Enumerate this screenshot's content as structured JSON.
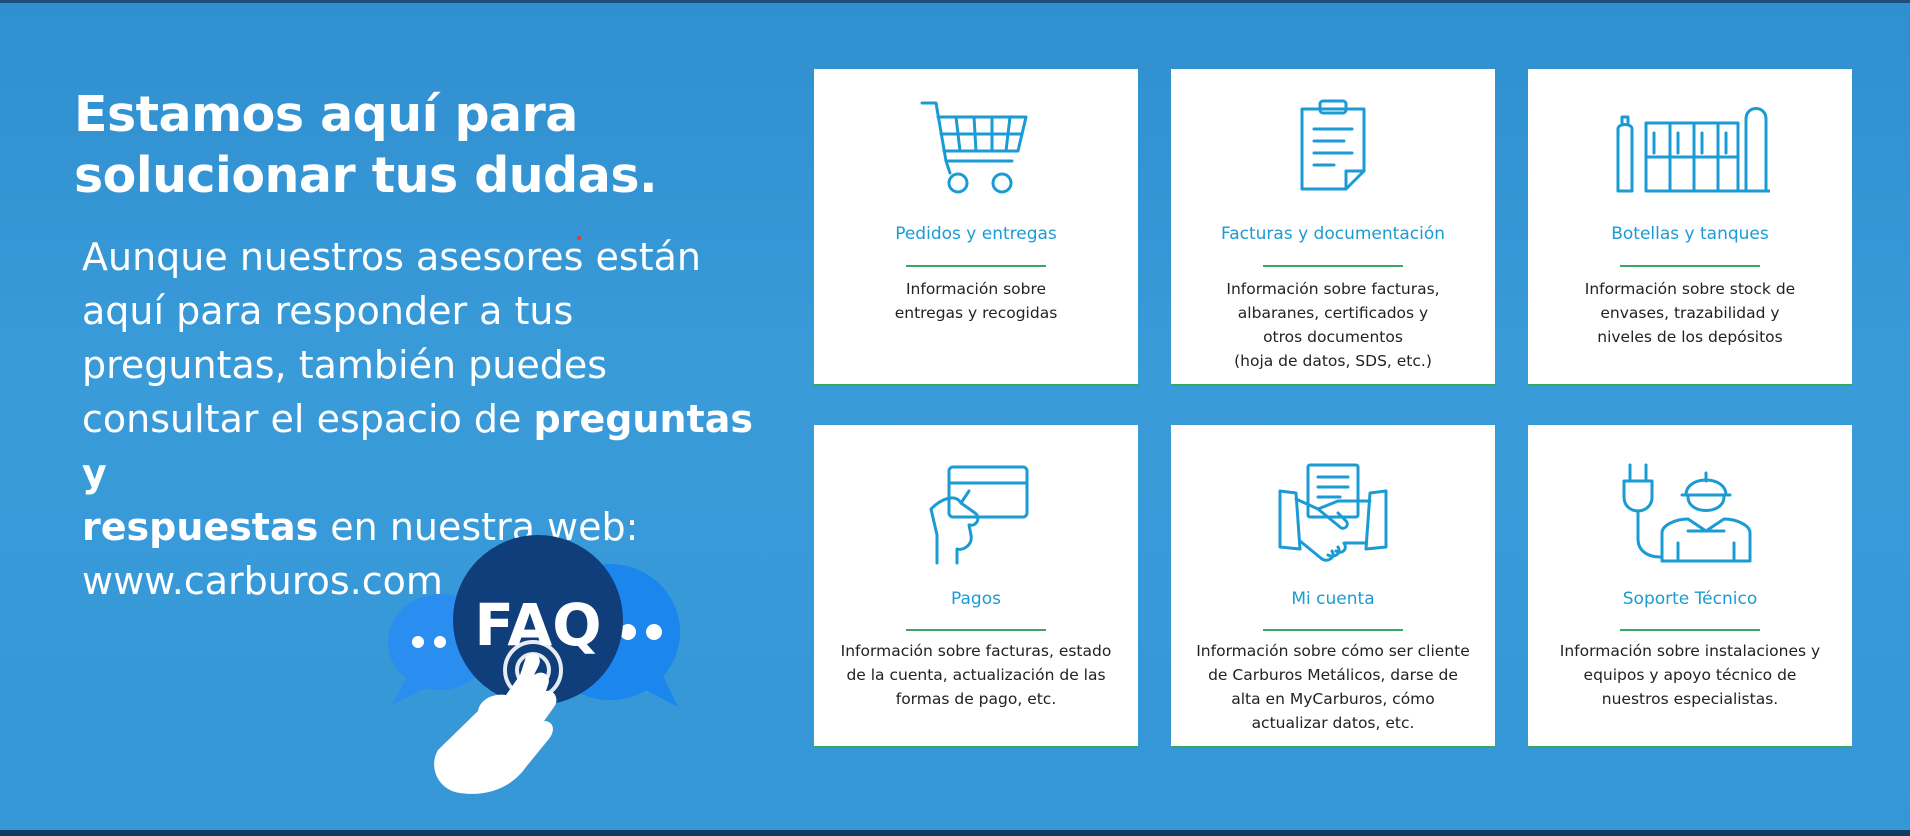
{
  "headline": {
    "line1": "Estamos aquí para",
    "line2": "solucionar tus dudas."
  },
  "intro": {
    "line1": "Aunque nuestros asesores están",
    "line2": "aquí para responder a tus",
    "line3": "preguntas, también puedes",
    "line4_normal": "consultar el espacio de ",
    "line4_bold": "preguntas y",
    "line5_bold": "respuestas",
    "line5_normal": " en nuestra web:",
    "line6": "www.carburos.com"
  },
  "faq_badge": {
    "label": "FAQ"
  },
  "colors": {
    "background": "#3597d6",
    "accent": "#1b9bd3",
    "rule": "#3aa860",
    "faq_dark": "#0f3e7a",
    "bubble": "#1a8cf0"
  },
  "cards": [
    {
      "icon": "shopping-cart-icon",
      "title": "Pedidos y entregas",
      "desc": [
        "Información sobre",
        "entregas y recogidas"
      ]
    },
    {
      "icon": "clipboard-icon",
      "title": "Facturas y documentación",
      "desc": [
        "Información sobre facturas,",
        "albaranes, certificados y",
        "otros documentos",
        "(hoja de datos, SDS, etc.)"
      ]
    },
    {
      "icon": "gas-cylinders-icon",
      "title": "Botellas y tanques",
      "desc": [
        "Información sobre stock de",
        "envases, trazabilidad y",
        "niveles de los depósitos"
      ]
    },
    {
      "icon": "credit-card-hand-icon",
      "title": "Pagos",
      "desc": [
        "Información sobre facturas, estado",
        "de la cuenta, actualización de las",
        "formas de pago, etc."
      ]
    },
    {
      "icon": "handshake-icon",
      "title": "Mi cuenta",
      "desc": [
        "Información sobre cómo ser cliente",
        "de Carburos Metálicos, darse de",
        "alta en MyCarburos, cómo",
        "actualizar datos, etc."
      ]
    },
    {
      "icon": "technician-plug-icon",
      "title": "Soporte Técnico",
      "desc": [
        "Información sobre instalaciones y",
        "equipos y apoyo técnico de",
        "nuestros especialistas."
      ]
    }
  ]
}
